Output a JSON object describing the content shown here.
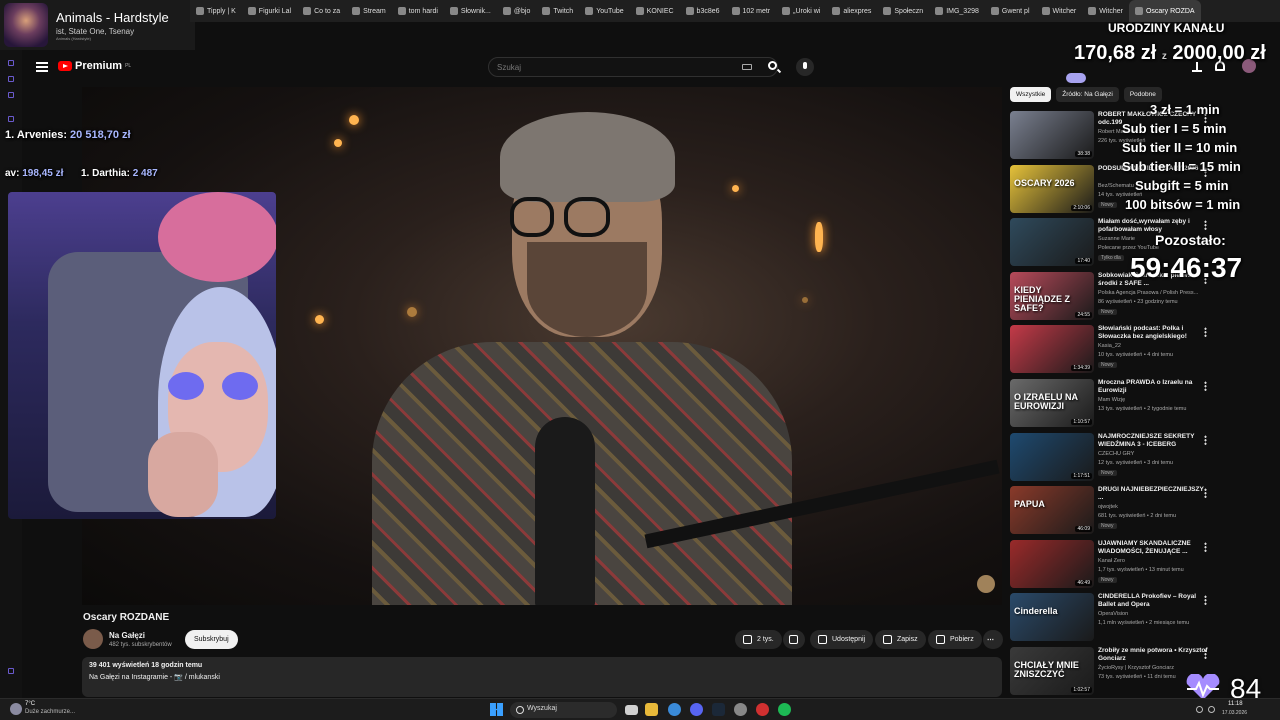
{
  "now_playing": {
    "title": "Animals - Hardstyle",
    "artist": "ist, State One, Tsenay",
    "album": "Animals (Hardstyle)"
  },
  "bookmarks": [
    {
      "label": "Tipply | K"
    },
    {
      "label": "Figurki Lal"
    },
    {
      "label": "Co to za"
    },
    {
      "label": "Stream"
    },
    {
      "label": "tom hardi"
    },
    {
      "label": "Słownik..."
    },
    {
      "label": "@bjo"
    },
    {
      "label": "Twitch"
    },
    {
      "label": "YouTube"
    },
    {
      "label": "KONIEC"
    },
    {
      "label": "b3c8e6"
    },
    {
      "label": "102 metr"
    },
    {
      "label": "„Uroki wi"
    },
    {
      "label": "aliexpres"
    },
    {
      "label": "Społeczn"
    },
    {
      "label": "IMG_3298"
    },
    {
      "label": "Gwent pl"
    },
    {
      "label": "Witcher"
    },
    {
      "label": "Witcher"
    },
    {
      "label": "Oscary ROZDA"
    }
  ],
  "yt": {
    "premium_label": "Premium",
    "premium_region": "PL",
    "search_placeholder": "Szukaj"
  },
  "video": {
    "title": "Oscary ROZDANE",
    "channel": "Na Gałęzi",
    "subs": "482 tys. subskrybentów",
    "subscribe": "Subskrybuj",
    "likes": "2 tys.",
    "share": "Udostępnij",
    "save": "Zapisz",
    "download": "Pobierz",
    "stats": "39 401 wyświetleń  18 godzin temu",
    "desc_line": "Na Gałęzi na Instagramie - 📷 / mlukanski"
  },
  "chips": [
    "Wszystkie",
    "Źródło: Na Gałęzi",
    "Podobne"
  ],
  "recs": [
    {
      "title": "ROBERT MAKŁOWICZ CZECHY odc.199",
      "channel": "Robert Makłowicz",
      "meta": "226 tys. wyświetleń",
      "dur": "38:38",
      "new": "",
      "color": "#7a8090"
    },
    {
      "title": "PODSUMOWANIE OSCARY 2026",
      "channel": "Bez/Schematu",
      "meta": "14 tys. wyświetleń",
      "dur": "2:10:06",
      "new": "Nowy",
      "color": "#e6c23a",
      "thumb_text": "OSCARY 2026"
    },
    {
      "title": "Miałam dość,wyrwałam zęby i pofarbowałam włosy",
      "channel": "Suzanne Marie",
      "meta": "Polecane przez YouTube",
      "dur": "17:40",
      "new": "Tylko dla",
      "color": "#2f4a5c"
    },
    {
      "title": "Sobkowiak-Czarnecka: pierwsze środki z SAFE ...",
      "channel": "Polska Agencja Prasowa / Polish Press...",
      "meta": "86 wyświetleń • 23 godziny temu",
      "dur": "24:55",
      "new": "Nowy",
      "color": "#b84a5a",
      "thumb_text": "KIEDY PIENIĄDZE Z SAFE?"
    },
    {
      "title": "Słowiański podcast: Polka i Słowaczka bez angielskiego!",
      "channel": "Kasia_22",
      "meta": "10 tys. wyświetleń • 4 dni temu",
      "dur": "1:34:39",
      "new": "Nowy",
      "color": "#c43a48"
    },
    {
      "title": "Mroczna PRAWDA o Izraelu na Eurowizji",
      "channel": "Mam Wizję",
      "meta": "13 tys. wyświetleń • 2 tygodnie temu",
      "dur": "1:10:57",
      "new": "",
      "color": "#6a6a6a",
      "thumb_text": "O IZRAELU NA EUROWIZJI"
    },
    {
      "title": "NAJMROCZNIEJSZE SEKRETY WIEDŹMINA 3 - ICEBERG",
      "channel": "CZECHU GRY",
      "meta": "12 tys. wyświetleń • 3 dni temu",
      "dur": "1:17:51",
      "new": "Nowy",
      "color": "#1e4a70"
    },
    {
      "title": "DRUGI NAJNIEBEZPIECZNIEJSZY ...",
      "channel": "ojwojtek",
      "meta": "681 tys. wyświetleń • 2 dni temu",
      "dur": "46:09",
      "new": "Nowy",
      "color": "#8a3a2a",
      "thumb_text": "PAPUA"
    },
    {
      "title": "UJAWNIAMY SKANDALICZNE WIADOMOŚCI, ŻENUJĄCE ...",
      "channel": "Kanał Zero",
      "meta": "1,7 tys. wyświetleń • 13 minut temu",
      "dur": "46:49",
      "new": "Nowy",
      "color": "#9a2a2a"
    },
    {
      "title": "CINDERELLA Prokofiev – Royal Ballet and Opera",
      "channel": "OperaVision",
      "meta": "1,1 mln wyświetleń • 2 miesiące temu",
      "dur": "",
      "new": "",
      "color": "#2a4a6a",
      "thumb_text": "Cinderella"
    },
    {
      "title": "Zrobiły ze mnie potwora • Krzysztof Gonciarz",
      "channel": "ŻycioRysy | Krzysztof Gonciarz",
      "meta": "73 tys. wyświetleń • 11 dni temu",
      "dur": "1:02:57",
      "new": "",
      "color": "#3a3a3a",
      "thumb_text": "CHCIAŁY MNIE ZNISZCZYĆ"
    }
  ],
  "overlay": {
    "top1_rank": "1.",
    "top1_name": "Arvenies:",
    "top1_amount": "20 518,70 zł",
    "av_label": "av:",
    "av_amount": "198,45 zł",
    "bits_rank": "1.",
    "bits_name": "Darthia:",
    "bits_amount": "2 487",
    "goal_title": "URODZINY KANAŁU",
    "goal_current": "170,68 zł",
    "goal_sep": "z",
    "goal_target": "2000,00 zł",
    "rates": [
      "3 zł = 1 min",
      "Sub tier I = 5 min",
      "Sub tier II = 10 min",
      "Sub tier III = 15 min",
      "Subgift = 5 min",
      "100 bitsów = 1 min"
    ],
    "remaining_label": "Pozostało:",
    "remaining_time": "59:46:37",
    "viewers": "84"
  },
  "taskbar": {
    "temp": "7°C",
    "weather": "Duże zachmurze...",
    "search": "Wyszukaj",
    "time": "11:18",
    "date": "17.03.2026"
  },
  "colors": {
    "yt_red": "#ff0000",
    "accent": "#a9b7ff",
    "bg": "#0f0f0f"
  }
}
